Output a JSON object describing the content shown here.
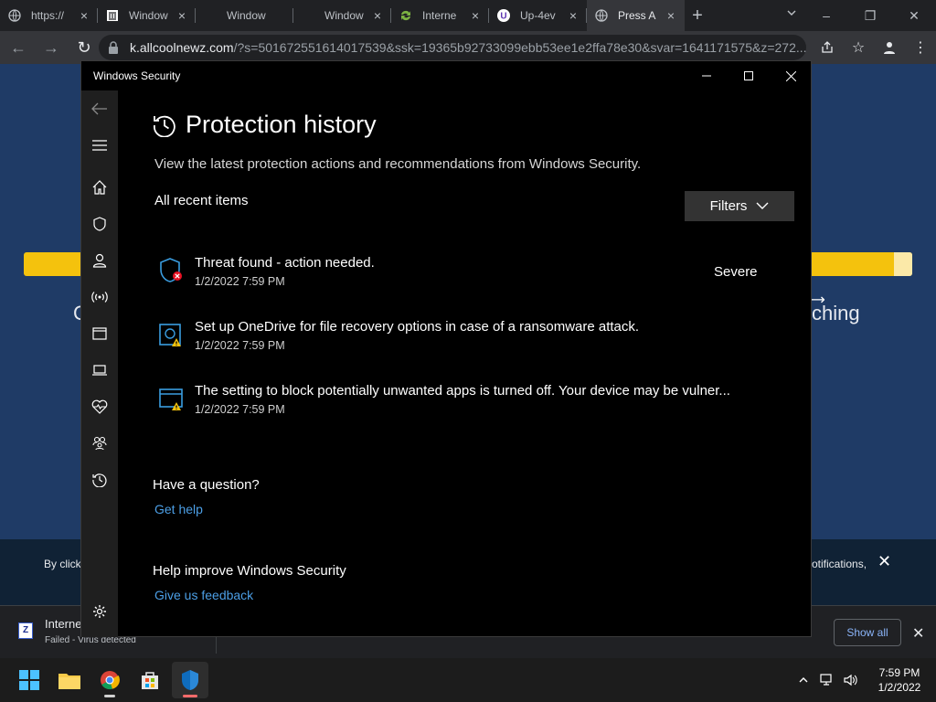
{
  "browser": {
    "tabs": [
      {
        "title": "https://",
        "icon": "globe-icon",
        "active": false
      },
      {
        "title": "Window",
        "icon": "bank-icon",
        "active": false
      },
      {
        "title": "Window",
        "icon": "",
        "active": false
      },
      {
        "title": "Window",
        "icon": "",
        "active": false
      },
      {
        "title": "Interne",
        "icon": "sync-icon",
        "active": false
      },
      {
        "title": "Up-4ev",
        "icon": "u-logo-icon",
        "active": false
      },
      {
        "title": "Press A",
        "icon": "globe-icon",
        "active": true
      }
    ],
    "url_host": "k.allcoolnewz.com",
    "url_rest": "/?s=501672551614017539&ssk=19365b92733099ebb53ee1e2ffa78e30&svar=1641171575&z=272..."
  },
  "background_page": {
    "left_text": "C",
    "right_text": "ching",
    "cookie_left": "By click",
    "cookie_right": "otifications,"
  },
  "download": {
    "file_name": "Interne",
    "status": "Failed - Virus detected",
    "show_all": "Show all"
  },
  "security_window": {
    "title": "Windows Security",
    "heading": "Protection history",
    "description": "View the latest protection actions and recommendations from Windows Security.",
    "recent_label": "All recent items",
    "filters_label": "Filters",
    "items": [
      {
        "text": "Threat found - action needed.",
        "time": "1/2/2022 7:59 PM",
        "severity": "Severe",
        "icon": "shield-threat-icon"
      },
      {
        "text": "Set up OneDrive for file recovery options in case of a ransomware attack.",
        "time": "1/2/2022 7:59 PM",
        "severity": "",
        "icon": "onedrive-warning-icon"
      },
      {
        "text": "The setting to block potentially unwanted apps is turned off. Your device may be vulner...",
        "time": "1/2/2022 7:59 PM",
        "severity": "",
        "icon": "app-browser-warning-icon"
      }
    ],
    "question_heading": "Have a question?",
    "question_link": "Get help",
    "improve_heading": "Help improve Windows Security",
    "improve_link": "Give us feedback"
  },
  "taskbar": {
    "time": "7:59 PM",
    "date": "1/2/2022"
  },
  "colors": {
    "link": "#4c9fe6",
    "sidebar": "#1f1f1f",
    "accent_shield": "#0f6cbd",
    "warning": "#f4c20d",
    "error": "#e81123"
  }
}
